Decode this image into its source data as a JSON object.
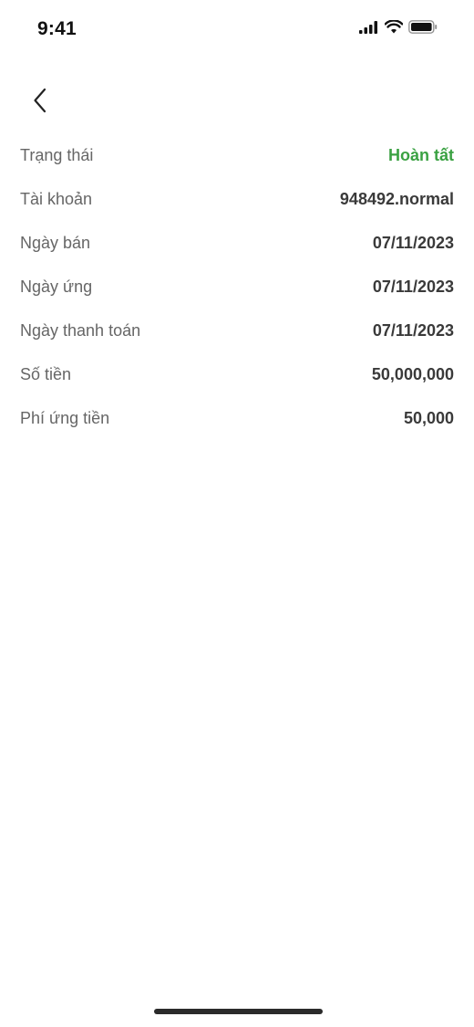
{
  "status_bar": {
    "time": "9:41",
    "icons": [
      "signal-icon",
      "wifi-icon",
      "battery-icon"
    ]
  },
  "nav": {
    "back_icon": "chevron-left-icon"
  },
  "details": {
    "rows": [
      {
        "label": "Trạng thái",
        "value": "Hoàn tất"
      },
      {
        "label": "Tài khoản",
        "value": "948492.normal"
      },
      {
        "label": "Ngày bán",
        "value": "07/11/2023"
      },
      {
        "label": "Ngày ứng",
        "value": "07/11/2023"
      },
      {
        "label": "Ngày thanh toán",
        "value": "07/11/2023"
      },
      {
        "label": "Số tiền",
        "value": "50,000,000"
      },
      {
        "label": "Phí ứng tiền",
        "value": "50,000"
      }
    ]
  },
  "colors": {
    "status_complete": "#3aa142",
    "label": "#666666",
    "value": "#3a3a3a"
  }
}
